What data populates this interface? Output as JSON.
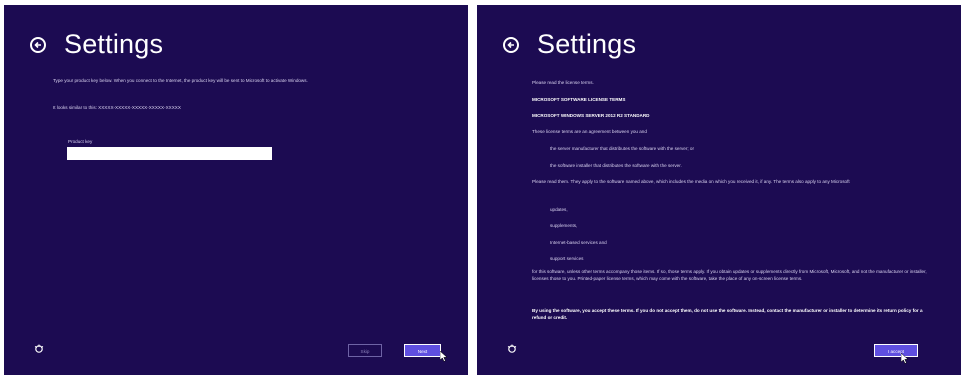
{
  "left": {
    "title": "Settings",
    "intro": "Type your product key below. When you connect to the Internet, the product key will be sent to Microsoft to activate Windows.",
    "example": "It looks similar to this: XXXXX-XXXXX-XXXXX-XXXXX-XXXXX",
    "product_key_label": "Product key",
    "product_key_value": "",
    "skip_label": "Skip",
    "next_label": "Next"
  },
  "right": {
    "title": "Settings",
    "read_terms": "Please read the license terms.",
    "heading1": "MICROSOFT SOFTWARE LICENSE TERMS",
    "heading2": "MICROSOFT WINDOWS SERVER 2012 R2 STANDARD",
    "agreement": "These license terms are an agreement between you and",
    "party1": "the server manufacturer that distributes the software with the server; or",
    "party2": "the software installer that distributes the software with the server.",
    "read_them": "Please read them. They apply to the software named above, which includes the media on which you received it, if any. The terms also apply to any Microsoft",
    "item1": "updates,",
    "item2": "supplements,",
    "item3": "Internet-based services and",
    "item4": "support services",
    "other_terms": "for this software, unless other terms accompany those items. If so, those terms apply. If you obtain updates or supplements directly from Microsoft, Microsoft, and not the manufacturer or installer, licenses those to you. Printed-paper license terms, which may come with the software, take the place of any on-screen license terms.",
    "by_using": "By using the software, you accept these terms. If you do not accept them, do not use the software. Instead, contact the manufacturer or installer to determine its return policy for a refund or credit.",
    "accept_label": "I accept"
  }
}
